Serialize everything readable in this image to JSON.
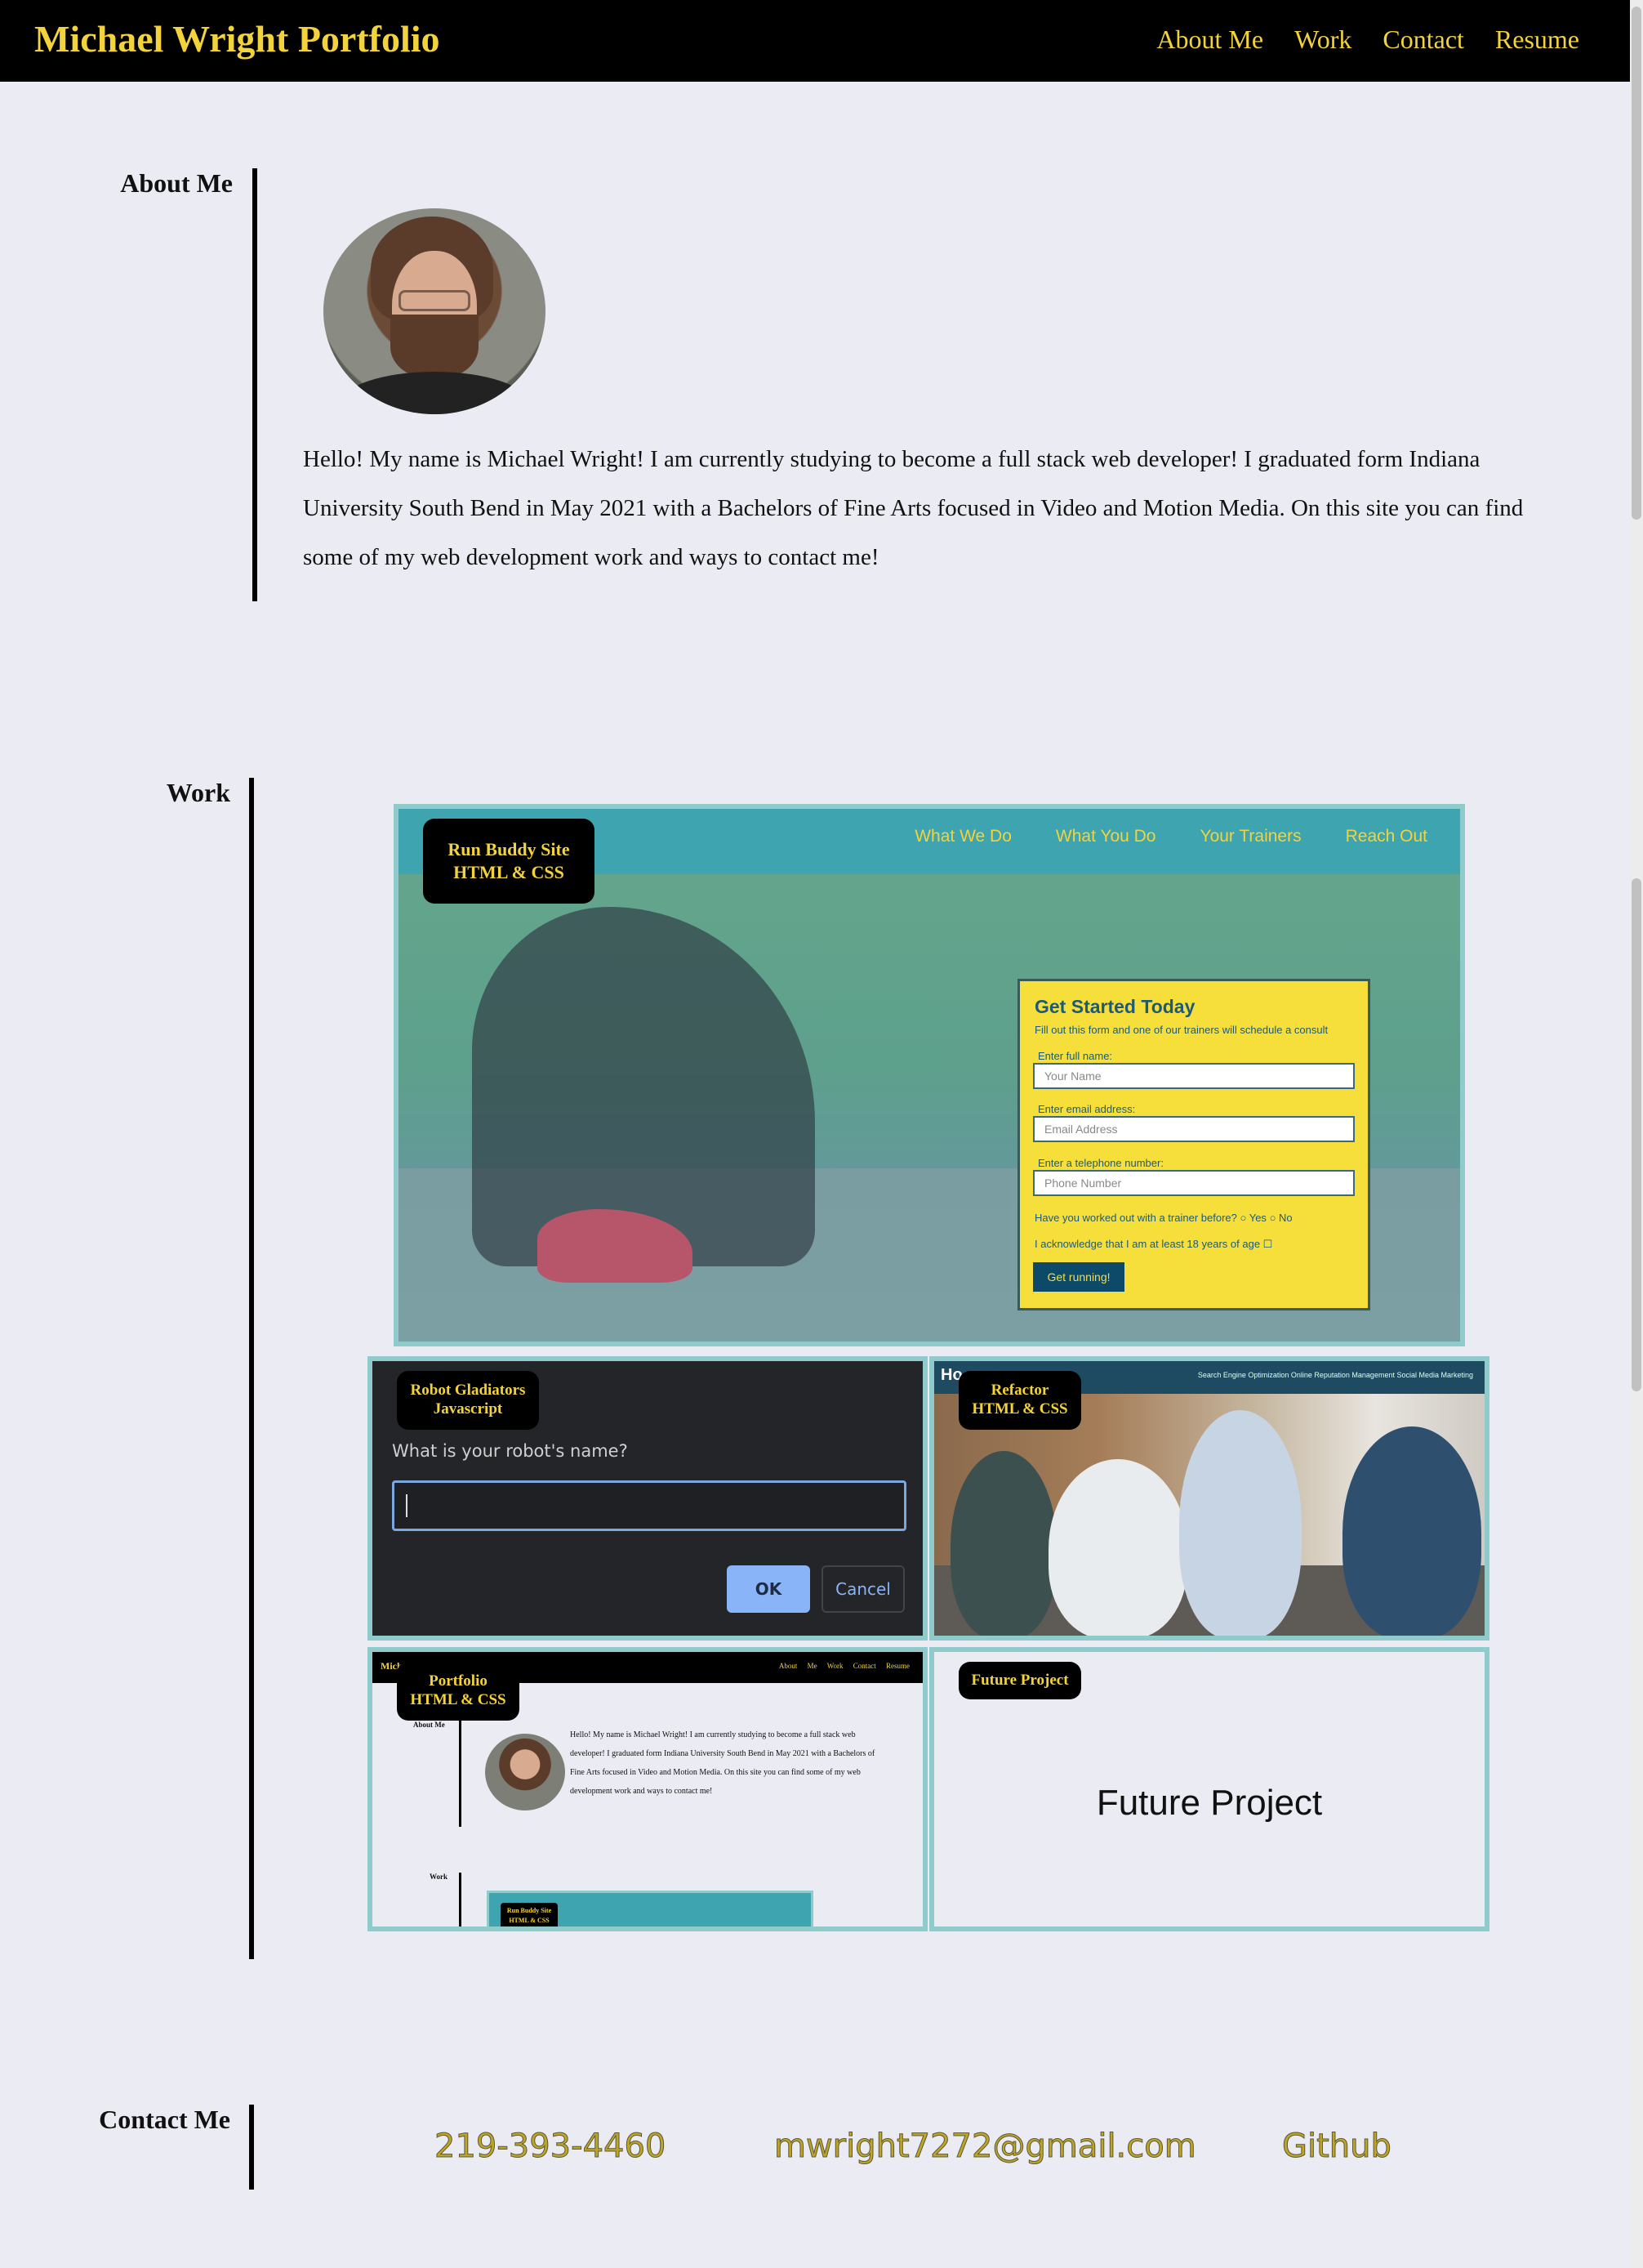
{
  "header": {
    "brand": "Michael Wright Portfolio",
    "nav": [
      "About Me",
      "Work",
      "Contact",
      "Resume"
    ]
  },
  "about": {
    "label": "About Me",
    "bio": "Hello! My name is Michael Wright! I am currently studying to become a full stack web developer! I graduated form Indiana University South Bend in May 2021 with a Bachelors of Fine Arts focused in Video and Motion Media. On this site you can find some of my web development work and ways to contact me!"
  },
  "work": {
    "label": "Work",
    "projects": [
      {
        "title": "Run Buddy Site",
        "tech": "HTML & CSS"
      },
      {
        "title": "Robot Gladiators",
        "tech": "Javascript"
      },
      {
        "title": "Refactor",
        "tech": "HTML & CSS"
      },
      {
        "title": "Portfolio",
        "tech": "HTML & CSS"
      },
      {
        "title": "Future Project",
        "tech": ""
      }
    ],
    "run_buddy_preview": {
      "nav": [
        "What We Do",
        "What You Do",
        "Your Trainers",
        "Reach Out"
      ],
      "form_title": "Get Started Today",
      "form_subtitle": "Fill out this form and one of our trainers will schedule a consult",
      "name_label": "Enter full name:",
      "name_placeholder": "Your Name",
      "email_label": "Enter email address:",
      "email_placeholder": "Email Address",
      "phone_label": "Enter a telephone number:",
      "phone_placeholder": "Phone Number",
      "trainer_question": "Have you worked out with a trainer before?",
      "yes": "Yes",
      "no": "No",
      "age_ack": "I acknowledge that I am at least 18 years of age",
      "button": "Get running!"
    },
    "robot_preview": {
      "prompt": "What is your robot's name?",
      "ok": "OK",
      "cancel": "Cancel"
    },
    "refactor_preview": {
      "heading": "Ho",
      "nav": "Search Engine Optimization    Online Reputation Management    Social Media Marketing"
    },
    "portfolio_preview": {
      "brand": "Michael Wright Portfolio",
      "nav": "About Me Work Contact Resume",
      "about_label": "About Me",
      "work_label": "Work",
      "bio": "Hello! My name is Michael Wright! I am currently studying to become a full stack web developer! I graduated form Indiana University South Bend in May 2021 with a Bachelors of Fine Arts focused in Video and Motion Media. On this site you can find some of my web development work and ways to contact me!",
      "mini_badge": "Run Buddy Site HTML & CSS"
    },
    "future_preview": {
      "text": "Future Project"
    }
  },
  "contact": {
    "label": "Contact Me",
    "phone": "219-393-4460",
    "email": "mwright7272@gmail.com",
    "github": "Github"
  },
  "colors": {
    "accent": "#f3d33b",
    "header_bg": "#000000",
    "page_bg": "#ebebf3",
    "tile_border": "#8fcbcb",
    "link": "#bfa527"
  }
}
